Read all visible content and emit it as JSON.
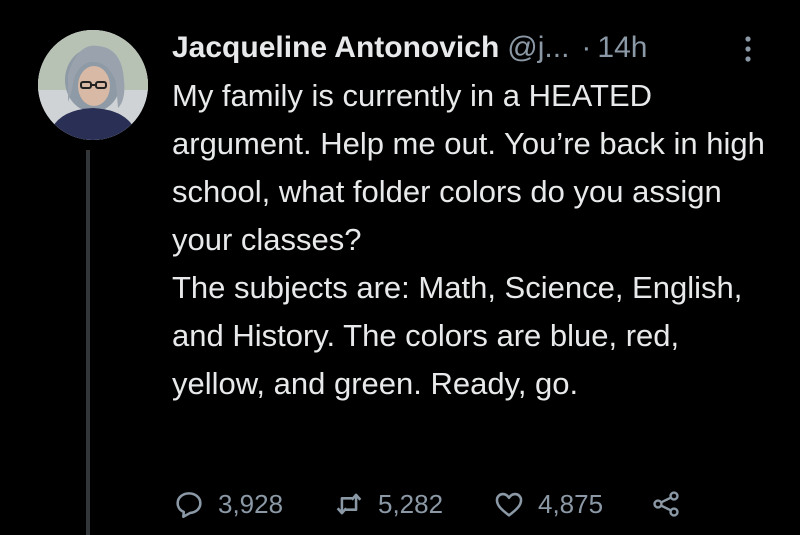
{
  "author": {
    "display_name": "Jacqueline Antonovich",
    "handle": "@j...",
    "separator": "·",
    "time": "14h"
  },
  "tweet": {
    "paragraph_1": "My family is currently in a HEATED argument. Help me out. You’re back in high school, what folder colors do you assign your classes?",
    "paragraph_2": "The subjects are: Math, Science, English, and History. The colors are blue, red, yellow, and green. Ready, go."
  },
  "actions": {
    "replies": "3,928",
    "retweets": "5,282",
    "likes": "4,875"
  },
  "icons": {
    "avatar": "avatar",
    "more": "more-vertical-icon",
    "reply": "reply-icon",
    "retweet": "retweet-icon",
    "like": "heart-icon",
    "share": "share-icon"
  },
  "colors": {
    "background": "#000000",
    "primary_text": "#e7e9ea",
    "secondary_text": "#8b98a5",
    "thread_line": "#333639"
  }
}
